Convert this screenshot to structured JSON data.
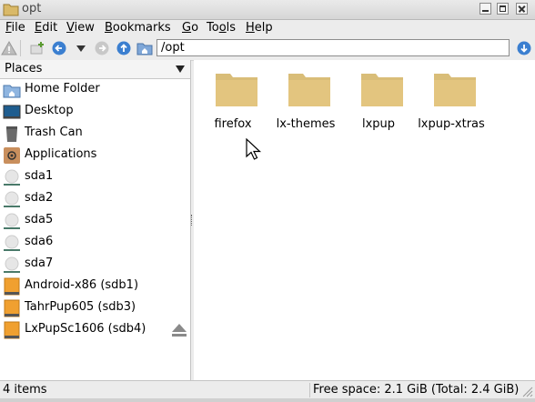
{
  "window": {
    "title": "opt"
  },
  "menu": [
    "File",
    "Edit",
    "View",
    "Bookmarks",
    "Go",
    "Tools",
    "Help"
  ],
  "toolbar": {
    "path": "/opt"
  },
  "sidebar": {
    "header": "Places",
    "items": [
      {
        "label": "Home Folder",
        "icon": "home-folder-icon"
      },
      {
        "label": "Desktop",
        "icon": "desktop-icon"
      },
      {
        "label": "Trash Can",
        "icon": "trash-can-icon"
      },
      {
        "label": "Applications",
        "icon": "applications-icon"
      },
      {
        "label": "sda1",
        "icon": "drive-icon"
      },
      {
        "label": "sda2",
        "icon": "drive-icon"
      },
      {
        "label": "sda5",
        "icon": "drive-icon"
      },
      {
        "label": "sda6",
        "icon": "drive-icon"
      },
      {
        "label": "sda7",
        "icon": "drive-icon"
      },
      {
        "label": "Android-x86 (sdb1)",
        "icon": "usb-drive-icon"
      },
      {
        "label": "TahrPup605 (sdb3)",
        "icon": "usb-drive-icon"
      },
      {
        "label": "LxPupSc1606 (sdb4)",
        "icon": "usb-drive-icon"
      }
    ]
  },
  "files": [
    {
      "name": "firefox"
    },
    {
      "name": "lx-themes"
    },
    {
      "name": "lxpup"
    },
    {
      "name": "lxpup-xtras"
    }
  ],
  "status": {
    "items": "4 items",
    "free_space": "Free space: 2.1 GiB (Total: 2.4 GiB)"
  },
  "colors": {
    "folder": "#e3c57f",
    "usb_drive": "#f0a030",
    "accent_blue": "#3b7fd0"
  }
}
